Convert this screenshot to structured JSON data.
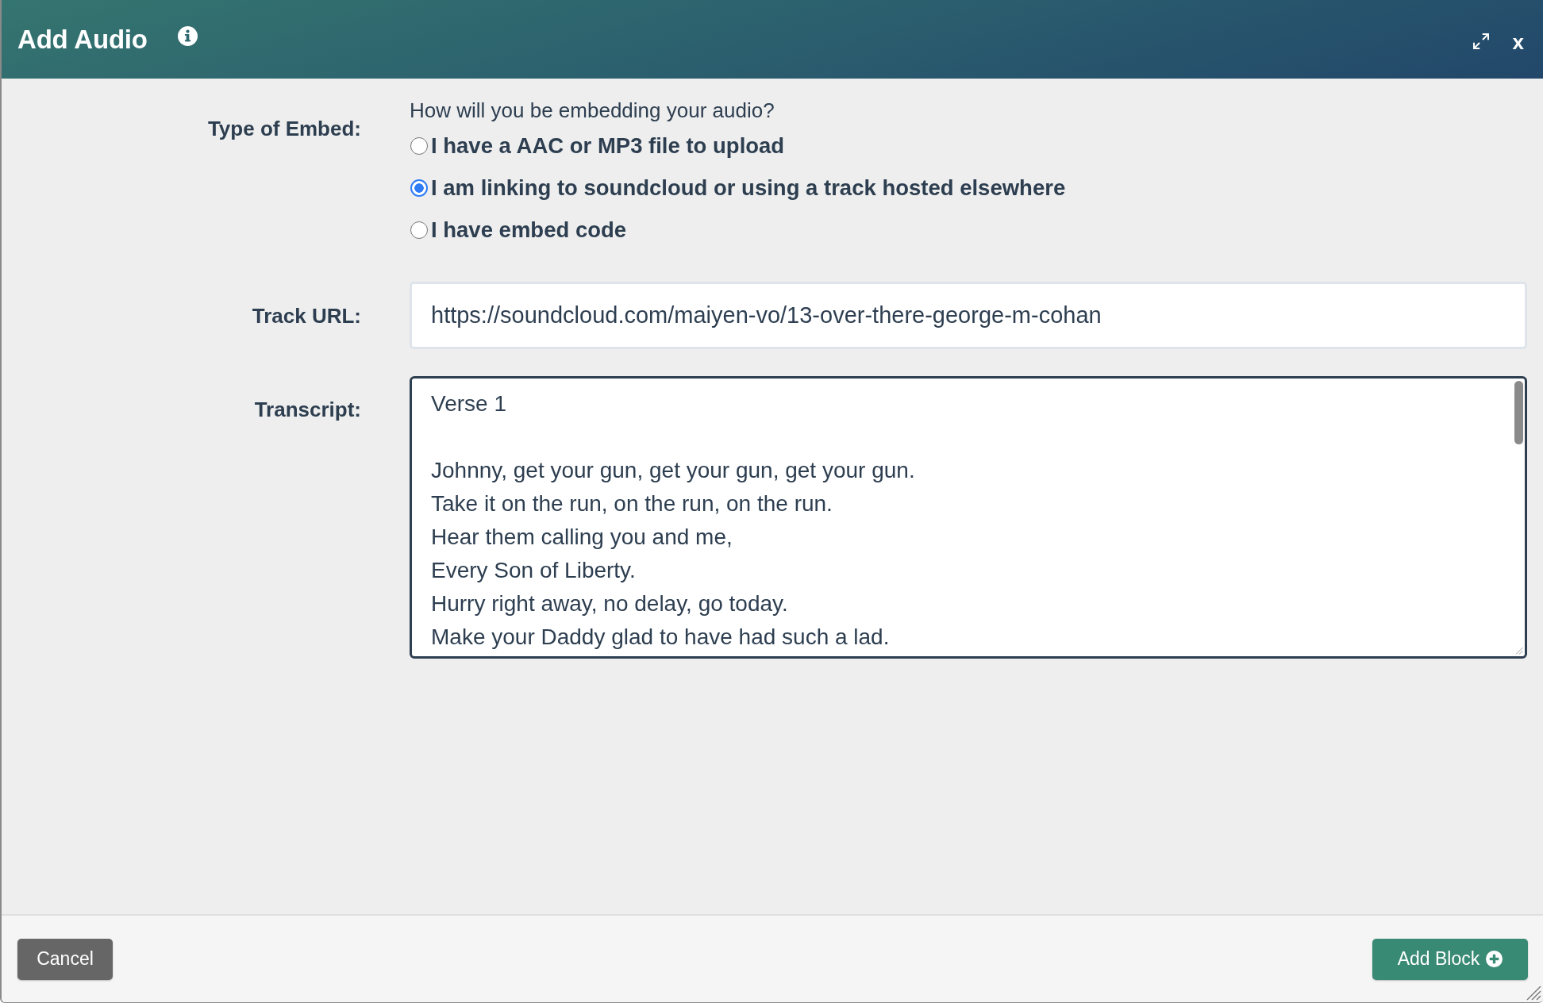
{
  "dialog": {
    "title": "Add Audio",
    "close_label": "x"
  },
  "type_of_embed": {
    "label": "Type of Embed:",
    "question": "How will you be embedding your audio?",
    "options": [
      {
        "label": "I have a AAC or MP3 file to upload",
        "selected": false
      },
      {
        "label": "I am linking to soundcloud or using a track hosted elsewhere",
        "selected": true
      },
      {
        "label": "I have embed code",
        "selected": false
      }
    ]
  },
  "track_url": {
    "label": "Track URL:",
    "value": "https://soundcloud.com/maiyen-vo/13-over-there-george-m-cohan"
  },
  "transcript": {
    "label": "Transcript:",
    "value": "Verse 1\n\nJohnny, get your gun, get your gun, get your gun.\nTake it on the run, on the run, on the run.\nHear them calling you and me,\nEvery Son of Liberty.\nHurry right away, no delay, go today.\nMake your Daddy glad to have had such a lad."
  },
  "footer": {
    "buttons": [
      {
        "label": "Cancel",
        "kind": "secondary"
      },
      {
        "label": "Add Block",
        "kind": "primary"
      }
    ]
  }
}
